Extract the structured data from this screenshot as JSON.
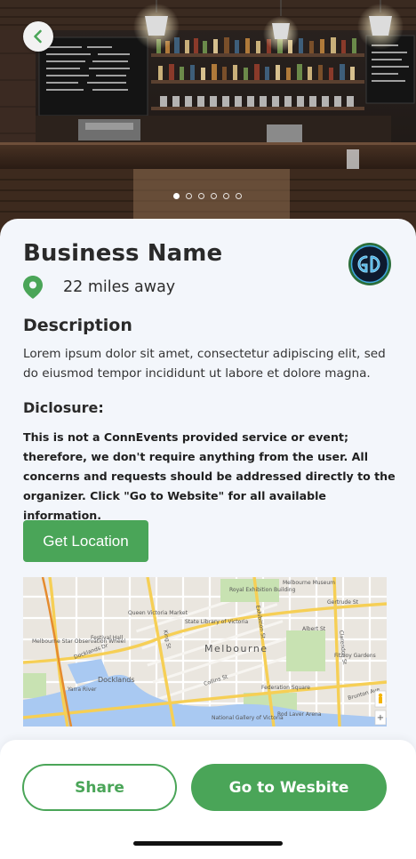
{
  "hero": {
    "photo": "bar-interior-photo",
    "back_icon": "chevron-left-icon",
    "carousel": {
      "count": 6,
      "active_index": 0
    }
  },
  "business": {
    "name": "Business Name",
    "distance": "22 miles away",
    "logo": "gd-neon-logo"
  },
  "description": {
    "title": "Description",
    "text": "Lorem ipsum dolor sit amet, consectetur adipiscing elit, sed do eiusmod tempor incididunt ut labore et dolore magna."
  },
  "disclosure": {
    "title": "Diclosure:",
    "text": "This is not a ConnEvents provided service or event; therefore, we don't require anything from the user. All concerns and requests should be addressed directly to the organizer. Click \"Go to Website\" for all available information."
  },
  "actions": {
    "get_location": "Get Location",
    "share": "Share",
    "go_to_website": "Go to Wesbite"
  },
  "map": {
    "city_label": "Melbourne",
    "labels": [
      "Melbourne Museum",
      "Royal Exhibition Building",
      "Gertrude St",
      "Queen Victoria Market",
      "State Library of Victoria",
      "Exhibition St",
      "Albert St",
      "Fitzroy Gardens",
      "Festival Hall",
      "Melbourne Star Observation Wheel",
      "Docklands Dr",
      "King St",
      "Docklands",
      "Collins St",
      "Yarra River",
      "Federation Square",
      "Rod Laver Arena",
      "National Gallery of Victoria",
      "Clarendon St",
      "Brunton Ave"
    ],
    "pegman_icon": "pegman-icon",
    "zoom_in_label": "+"
  },
  "colors": {
    "accent": "#4aa558",
    "background": "#f3f6fb",
    "text": "#2a2a2a"
  }
}
